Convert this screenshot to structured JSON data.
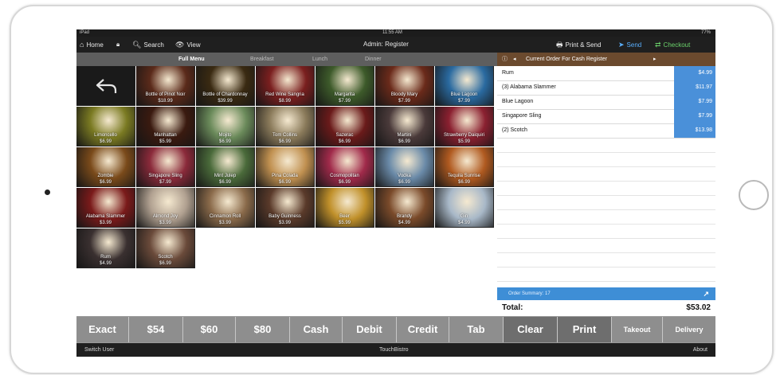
{
  "status": {
    "carrier": "iPad",
    "time": "11:55 AM",
    "battery": "77%"
  },
  "nav": {
    "home": "Home",
    "search": "Search",
    "view": "View",
    "title": "Admin: Register",
    "print_send": "Print & Send",
    "send": "Send",
    "checkout": "Checkout"
  },
  "menu_tabs": [
    "Full Menu",
    "Breakfast",
    "Lunch",
    "Dinner"
  ],
  "order": {
    "header": "Current Order For Cash Register",
    "items": [
      {
        "name": "Rum",
        "price": "$4.99"
      },
      {
        "name": "(3) Alabama Slammer",
        "price": "$11.97"
      },
      {
        "name": "Blue Lagoon",
        "price": "$7.99"
      },
      {
        "name": "Singapore Sling",
        "price": "$7.99"
      },
      {
        "name": "(2) Scotch",
        "price": "$13.98"
      }
    ],
    "summary": "Order Summary: 17",
    "total_label": "Total:",
    "total_value": "$53.02"
  },
  "drinks": [
    {
      "name": "Bottle of Pinot Noir",
      "price": "$18.99"
    },
    {
      "name": "Bottle of Chardonnay",
      "price": "$39.99"
    },
    {
      "name": "Red Wine Sangria",
      "price": "$8.99"
    },
    {
      "name": "Margarita",
      "price": "$7.99"
    },
    {
      "name": "Bloody Mary",
      "price": "$7.99"
    },
    {
      "name": "Blue Lagoon",
      "price": "$7.99"
    },
    {
      "name": "Limoncello",
      "price": "$6.99"
    },
    {
      "name": "Manhattan",
      "price": "$5.99"
    },
    {
      "name": "Mojito",
      "price": "$6.99"
    },
    {
      "name": "Tom Collins",
      "price": "$6.99"
    },
    {
      "name": "Sazerac",
      "price": "$6.99"
    },
    {
      "name": "Martini",
      "price": "$6.99"
    },
    {
      "name": "Strawberry Daiquiri",
      "price": "$5.99"
    },
    {
      "name": "Zombie",
      "price": "$6.99"
    },
    {
      "name": "Singapore Sling",
      "price": "$7.99"
    },
    {
      "name": "Mint Julep",
      "price": "$6.99"
    },
    {
      "name": "Pina Colada",
      "price": "$6.99"
    },
    {
      "name": "Cosmopolitan",
      "price": "$6.99"
    },
    {
      "name": "Vodka",
      "price": "$6.99"
    },
    {
      "name": "Tequila Sunrise",
      "price": "$6.99"
    },
    {
      "name": "Alabama Slammer",
      "price": "$3.99"
    },
    {
      "name": "Almond Joy",
      "price": "$3.99"
    },
    {
      "name": "Cinnamon Roll",
      "price": "$3.99"
    },
    {
      "name": "Baby Guinness",
      "price": "$3.99"
    },
    {
      "name": "Beer",
      "price": "$5.99"
    },
    {
      "name": "Brandy",
      "price": "$4.99"
    },
    {
      "name": "Gin",
      "price": "$4.99"
    },
    {
      "name": "Rum",
      "price": "$4.99"
    },
    {
      "name": "Scotch",
      "price": "$6.99"
    }
  ],
  "pay_buttons": [
    "Exact",
    "$54",
    "$60",
    "$80",
    "Cash",
    "Debit",
    "Credit",
    "Tab"
  ],
  "action_buttons": [
    "Clear",
    "Print",
    "Takeout",
    "Delivery"
  ],
  "footer": {
    "left": "Switch User",
    "center": "TouchBistro",
    "right": "About"
  },
  "colors": {
    "accent_blue": "#4a90d9",
    "order_header_brown": "#6b4a2e",
    "checkout_green": "#6bd36b"
  }
}
